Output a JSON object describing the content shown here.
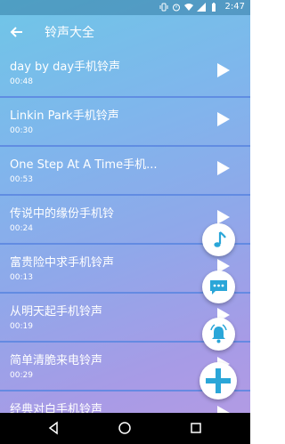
{
  "status": {
    "time": "2:47",
    "icons": [
      "vibrate-icon",
      "alarm-icon",
      "wifi-icon",
      "signal-icon",
      "battery-icon"
    ]
  },
  "appbar": {
    "title": "铃声大全",
    "back_icon": "arrow-back-icon"
  },
  "ringtones": [
    {
      "name": "day by day手机铃声",
      "duration": "00:48"
    },
    {
      "name": "Linkin Park手机铃声",
      "duration": "00:30"
    },
    {
      "name": "One Step At A Time手机...",
      "duration": "00:53"
    },
    {
      "name": "传说中的缘份手机铃",
      "duration": "00:24"
    },
    {
      "name": "富贵险中求手机铃声",
      "duration": "00:13"
    },
    {
      "name": "从明天起手机铃声",
      "duration": "00:19"
    },
    {
      "name": "简单清脆来电铃声",
      "duration": "00:29"
    },
    {
      "name": "经典对白手机铃声",
      "duration": ""
    }
  ],
  "fabs": [
    "music-note-icon",
    "message-icon",
    "notification-bell-icon",
    "add-icon"
  ],
  "navbar": [
    "nav-back-icon",
    "nav-home-icon",
    "nav-recents-icon"
  ],
  "colors": {
    "accent": "#2aa6d8",
    "divider": "#5b86e0"
  }
}
